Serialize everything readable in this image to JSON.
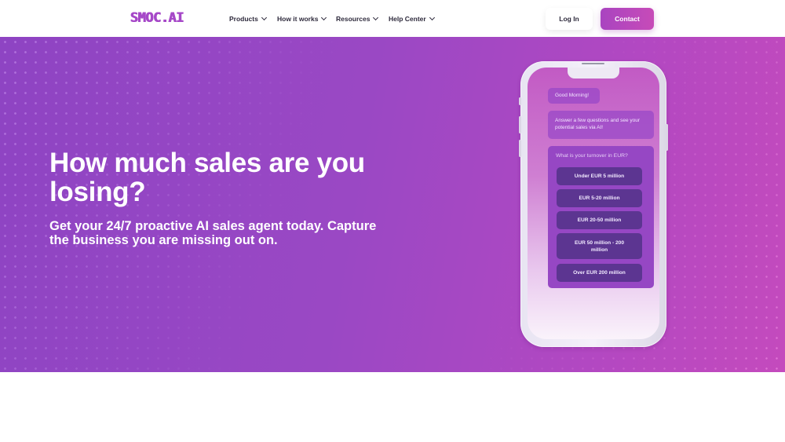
{
  "nav": {
    "logo": "SMOC.AI",
    "menu": [
      {
        "label": "Products"
      },
      {
        "label": "How it works"
      },
      {
        "label": "Resources"
      },
      {
        "label": "Help Center"
      }
    ],
    "login_label": "Log In",
    "contact_label": "Contact"
  },
  "hero": {
    "headline": "How much sales are you losing?",
    "subline": "Get your 24/7 proactive AI sales agent today. Capture the business you are missing out on."
  },
  "phone": {
    "greeting": "Good Morning!",
    "intro": "Answer a few questions and see your potential sales via AI!",
    "question": "What is your turnover in EUR?",
    "options": [
      {
        "label": "Under EUR 5 million"
      },
      {
        "label": "EUR 5-20 million"
      },
      {
        "label": "EUR 20-50 million"
      },
      {
        "label": "EUR 50 million - 200 million"
      },
      {
        "label": "Over EUR 200 million"
      }
    ]
  },
  "colors": {
    "brand": "#a648c8",
    "hero_start": "#8e44c3",
    "hero_end": "#c44abd",
    "option_bg": "#5c3591"
  }
}
